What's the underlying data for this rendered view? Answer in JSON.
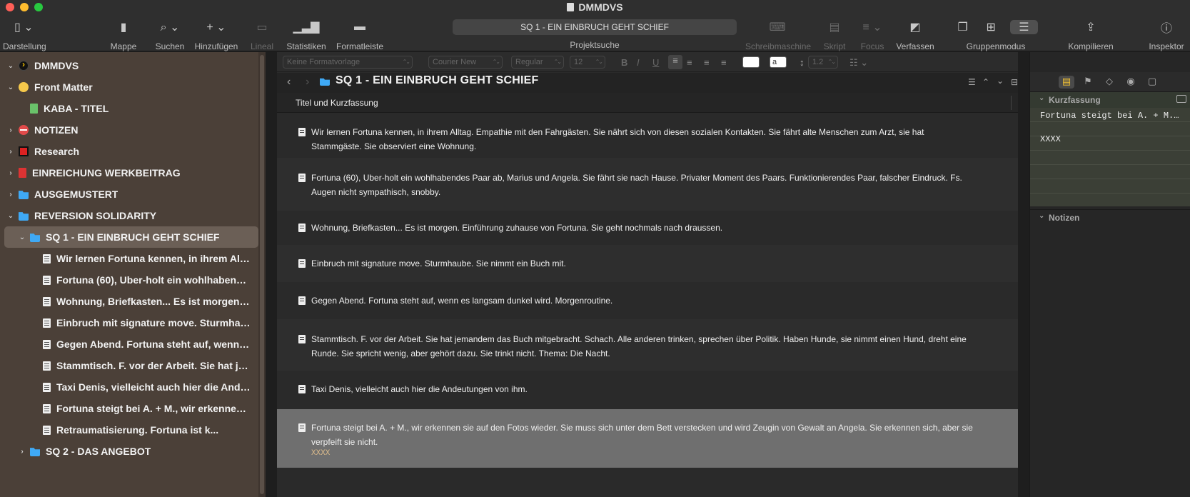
{
  "window": {
    "title": "DMMDVS"
  },
  "toolbar": {
    "items": [
      {
        "label": "Darstellung"
      },
      {
        "label": "Mappe"
      },
      {
        "label": "Suchen"
      },
      {
        "label": "Hinzufügen"
      },
      {
        "label": "Lineal"
      },
      {
        "label": "Statistiken"
      },
      {
        "label": "Formatleiste"
      },
      {
        "label": "Schreibmaschine"
      },
      {
        "label": "Skript"
      },
      {
        "label": "Focus"
      },
      {
        "label": "Verfassen"
      },
      {
        "label": "Gruppenmodus"
      },
      {
        "label": "Kompilieren"
      },
      {
        "label": "Inspektor"
      }
    ],
    "search_value": "SQ 1 - EIN EINBRUCH GEHT SCHIEF",
    "search_label": "Projektsuche"
  },
  "format_bar": {
    "style": "Keine Formatvorlage",
    "font": "Courier New",
    "weight": "Regular",
    "size": "12",
    "bold": "B",
    "italic": "I",
    "underline": "U",
    "line_spacing": "1.2",
    "highlight": "a"
  },
  "binder": {
    "items": [
      {
        "label": "DMMDVS"
      },
      {
        "label": "Front Matter"
      },
      {
        "label": "KABA - TITEL"
      },
      {
        "label": "NOTIZEN"
      },
      {
        "label": "Research"
      },
      {
        "label": "EINREICHUNG WERKBEITRAG"
      },
      {
        "label": "AUSGEMUSTERT"
      },
      {
        "label": "REVERSION SOLIDARITY"
      },
      {
        "label": "SQ 1 - EIN EINBRUCH GEHT SCHIEF"
      },
      {
        "label": "Wir lernen Fortuna kennen, in ihrem Alltag. Empathie mit den Fahrgästen."
      },
      {
        "label": "Fortuna (60), Uber-holt ein wohlhabendes Paar ab, Marius und Angela."
      },
      {
        "label": "Wohnung, Briefkasten... Es ist morgen. Einführung zuhause von Fortuna."
      },
      {
        "label": "Einbruch mit signature move. Sturmhaube. Sie nimmt ein Buch mit."
      },
      {
        "label": "Gegen Abend. Fortuna steht auf, wenn es langsam dunkel wird."
      },
      {
        "label": "Stammtisch. F. vor der Arbeit. Sie hat jemandem das Buch mitgebracht."
      },
      {
        "label": "Taxi Denis, vielleicht auch hier die Andeutungen von ihm."
      },
      {
        "label": "Fortuna steigt bei A. + M., wir erkennen sie auf den Fotos wieder."
      },
      {
        "label": "Retraumatisierung. Fortuna ist k..."
      },
      {
        "label": "SQ 2 - DAS ANGEBOT"
      }
    ]
  },
  "editor": {
    "title": "SQ 1 - EIN EINBRUCH GEHT SCHIEF",
    "subheader": "Titel und Kurzfassung",
    "cards": [
      {
        "text": "Wir lernen Fortuna kennen, in ihrem Alltag. Empathie mit den Fahrgästen.  Sie nährt sich von diesen sozialen Kontakten. Sie fährt alte Menschen zum Arzt, sie hat Stammgäste. Sie observiert eine Wohnung."
      },
      {
        "text": "Fortuna (60), Uber-holt ein wohlhabendes Paar ab, Marius und Angela. Sie fährt sie nach Hause. Privater Moment des Paars. Funktionierendes Paar, falscher Eindruck. Fs. Augen nicht sympathisch, snobby."
      },
      {
        "text": "Wohnung, Briefkasten... Es ist morgen. Einführung zuhause von Fortuna. Sie geht nochmals nach draussen."
      },
      {
        "text": "Einbruch mit signature move. Sturmhaube.  Sie  nimmt ein Buch mit."
      },
      {
        "text": "Gegen Abend. Fortuna steht auf, wenn es langsam dunkel wird. Morgenroutine."
      },
      {
        "text": "Stammtisch. F. vor der Arbeit. Sie hat jemandem das Buch mitgebracht. Schach. Alle anderen trinken, sprechen über Politik. Haben Hunde, sie nimmt einen Hund, dreht eine Runde. Sie spricht wenig, aber gehört dazu. Sie trinkt nicht. Thema: Die Nacht."
      },
      {
        "text": "Taxi Denis, vielleicht auch hier die Andeutungen von ihm."
      },
      {
        "text": "Fortuna steigt bei A. + M., wir erkennen sie auf den Fotos wieder. Sie muss sich unter dem Bett verstecken und wird Zeugin von Gewalt an Angela. Sie erkennen sich, aber sie verpfeift sie nicht.",
        "note": "XXXX"
      }
    ]
  },
  "inspector": {
    "synopsis_title": "Kurzfassung",
    "synopsis_text": "Fortuna steigt bei A. + M., wir erkennen sie auf den Fotos wieder.",
    "synopsis_note": "XXXX",
    "notes_title": "Notizen"
  },
  "colors": {
    "binder_bg": "#4b4038",
    "folder": "#3fa9f5",
    "selected_card": "#6f6f6f",
    "inspector_synopsis_bg": "#3b3f36"
  }
}
